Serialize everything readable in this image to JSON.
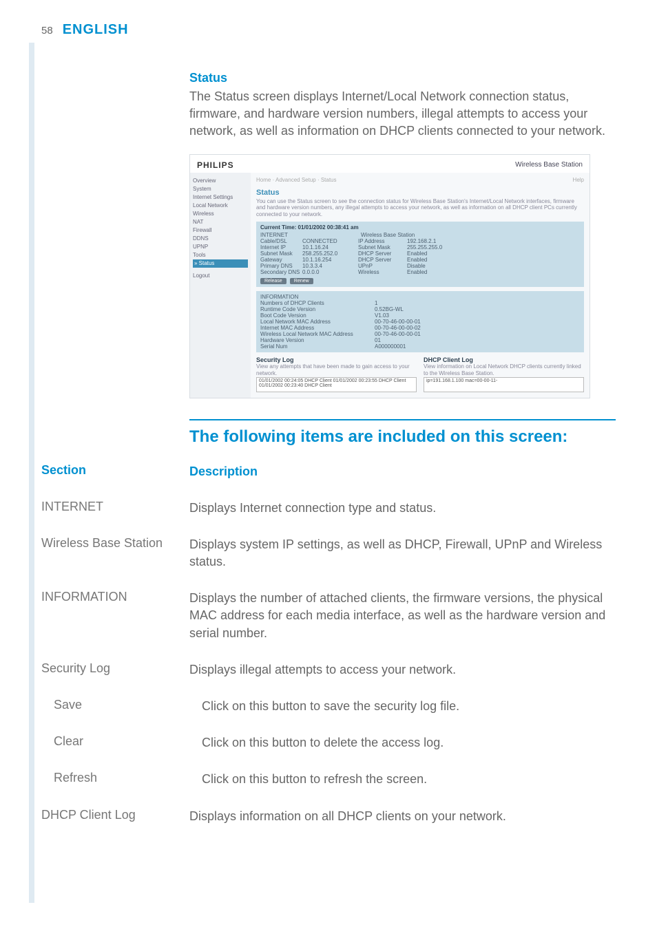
{
  "page": {
    "number": "58",
    "language": "ENGLISH"
  },
  "status": {
    "title": "Status",
    "body": "The Status screen displays Internet/Local Network connection status, firmware, and hardware version numbers, illegal attempts to access your network, as well as information on DHCP clients connected to your network."
  },
  "screenshot": {
    "logo": "PHILIPS",
    "product": "Wireless Base Station",
    "nav": {
      "items": [
        "Overview",
        "System",
        "Internet Settings",
        "Local Network",
        "Wireless",
        "NAT",
        "Firewall",
        "DDNS",
        "UPNP",
        "Tools"
      ],
      "selected": "» Status",
      "logout": "Logout"
    },
    "crumb": "Home · Advanced Setup · Status",
    "help": "Help",
    "heading": "Status",
    "desc": "You can use the Status screen to see the connection status for Wireless Base Station's Internet/Local Network interfaces, firmware and hardware version numbers, any illegal attempts to access your network, as well as information on all DHCP client PCs currently connected to your network.",
    "time_label": "Current Time: 01/01/2002 00:38:41 am",
    "panel1": {
      "col1": "INTERNET",
      "col2": "Wireless Base Station",
      "rows": [
        {
          "a": "Cable/DSL",
          "b": "CONNECTED",
          "c": "IP Address",
          "d": "192.168.2.1"
        },
        {
          "a": "Internet IP",
          "b": "10.1.16.24",
          "c": "Subnet Mask",
          "d": "255.255.255.0"
        },
        {
          "a": "Subnet Mask",
          "b": "258.255.252.0",
          "c": "DHCP Server",
          "d": "Enabled"
        },
        {
          "a": "Gateway",
          "b": "10.1.16.254",
          "c": "DHCP Server",
          "d": "Enabled"
        },
        {
          "a": "Primary DNS",
          "b": "10.3.3.4",
          "c": "UPnP",
          "d": "Disable"
        },
        {
          "a": "Secondary DNS",
          "b": "0.0.0.0",
          "c": "Wireless",
          "d": "Enabled"
        }
      ],
      "buttons": [
        "Release",
        "Renew"
      ]
    },
    "panel2": {
      "title": "INFORMATION",
      "rows": [
        {
          "a": "Numbers of DHCP Clients",
          "b": "1"
        },
        {
          "a": "Runtime Code Version",
          "b": "0.52BG-WL"
        },
        {
          "a": "Boot Code Version",
          "b": "V1.03"
        },
        {
          "a": "Local Network MAC Address",
          "b": "00-70-46-00-00-01"
        },
        {
          "a": "Internet MAC Address",
          "b": "00-70-46-00-00-02"
        },
        {
          "a": "Wireless Local Network MAC Address",
          "b": "00-70-46-00-00-01"
        },
        {
          "a": "Hardware Version",
          "b": "01"
        },
        {
          "a": "Serial Num",
          "b": "A000000001"
        }
      ]
    },
    "lower": {
      "sec_title": "Security Log",
      "sec_desc": "View any attempts that have been made to gain access to your network.",
      "sec_box": "01/01/2002  00:24:05 DHCP Client\n01/01/2002  00:23:55 DHCP Client\n01/01/2002  00:23:40 DHCP Client",
      "dhcp_title": "DHCP Client Log",
      "dhcp_desc": "View information on Local Network DHCP clients currently linked to the Wireless Base Station.",
      "dhcp_box": "ip=191.168.1.100   mac=00-00-11-"
    }
  },
  "tableHeader": "The following items are included on this screen:",
  "columns": {
    "section": "Section",
    "description": "Description"
  },
  "rows": [
    {
      "section": "INTERNET",
      "desc": "Displays Internet connection type and status.",
      "indent": false
    },
    {
      "section": "Wireless Base Station",
      "desc": "Displays system IP settings, as well as DHCP, Firewall, UPnP and Wireless status.",
      "indent": false
    },
    {
      "section": "INFORMATION",
      "desc": "Displays the number of attached clients, the firmware versions, the physical MAC address for each media interface, as well as the hardware version and serial number.",
      "indent": false
    },
    {
      "section": "Security Log",
      "desc": "Displays illegal attempts to access your network.",
      "indent": false
    },
    {
      "section": "Save",
      "desc": "Click on this button to save the security log file.",
      "indent": true
    },
    {
      "section": "Clear",
      "desc": "Click on this button to delete the access log.",
      "indent": true
    },
    {
      "section": "Refresh",
      "desc": "Click on this button to refresh the screen.",
      "indent": true
    },
    {
      "section": "DHCP Client Log",
      "desc": "Displays information on all DHCP clients on your network.",
      "indent": false
    }
  ]
}
